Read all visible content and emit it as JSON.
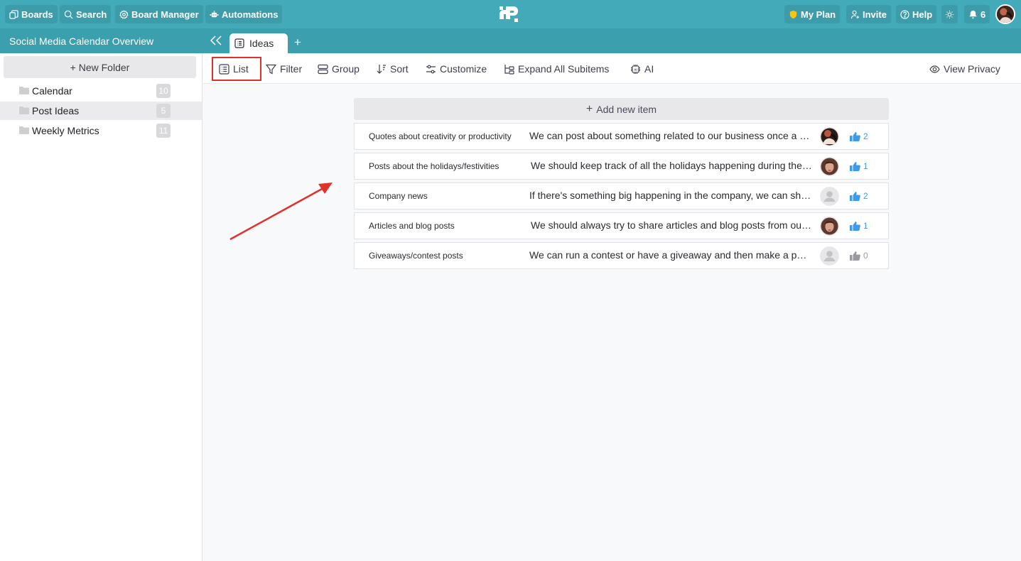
{
  "topbar": {
    "left_buttons": [
      {
        "label": "Boards",
        "icon": "boards-icon"
      },
      {
        "label": "Search",
        "icon": "search-icon"
      },
      {
        "label": "Board Manager",
        "icon": "gear-icon"
      },
      {
        "label": "Automations",
        "icon": "robot-icon"
      }
    ],
    "right_buttons": {
      "my_plan": "My Plan",
      "invite": "Invite",
      "help": "Help",
      "notifications_count": "6"
    },
    "colors": {
      "bar": "#43aab9",
      "plan_shield": "#f5c518"
    }
  },
  "board": {
    "title": "Social Media Calendar Overview",
    "tabs": [
      {
        "label": "Ideas",
        "active": true
      }
    ],
    "add_tab": "+"
  },
  "sidebar": {
    "new_folder_label": "+ New Folder",
    "folders": [
      {
        "name": "Calendar",
        "count": "10",
        "active": false
      },
      {
        "name": "Post Ideas",
        "count": "5",
        "active": true
      },
      {
        "name": "Weekly Metrics",
        "count": "11",
        "active": false
      }
    ]
  },
  "toolbar": {
    "list": "List",
    "filter": "Filter",
    "group": "Group",
    "sort": "Sort",
    "customize": "Customize",
    "expand": "Expand All Subitems",
    "ai": "AI",
    "view_privacy": "View Privacy",
    "highlight_color": "#e0312b"
  },
  "main": {
    "add_item_label": "Add new item",
    "items": [
      {
        "title": "Quotes about creativity or productivity",
        "description": "We can post about something related to our business once a week",
        "avatar": "photo-a",
        "likes": "2",
        "liked": true
      },
      {
        "title": "Posts about the holidays/festivities",
        "description": "We should keep track of all the holidays happening during the year",
        "avatar": "photo-b",
        "likes": "1",
        "liked": true
      },
      {
        "title": "Company news",
        "description": "If there's something big happening in the company, we can share it",
        "avatar": "placeholder",
        "likes": "2",
        "liked": true
      },
      {
        "title": "Articles and blog posts",
        "description": "We should always try to share articles and blog posts from our website",
        "avatar": "photo-b",
        "likes": "1",
        "liked": true
      },
      {
        "title": "Giveaways/contest posts",
        "description": "We can run a contest or have a giveaway and then make a post about it",
        "avatar": "placeholder",
        "likes": "0",
        "liked": false
      }
    ],
    "like_color_active": "#3d9be9",
    "like_color_inactive": "#9a9aa2"
  }
}
